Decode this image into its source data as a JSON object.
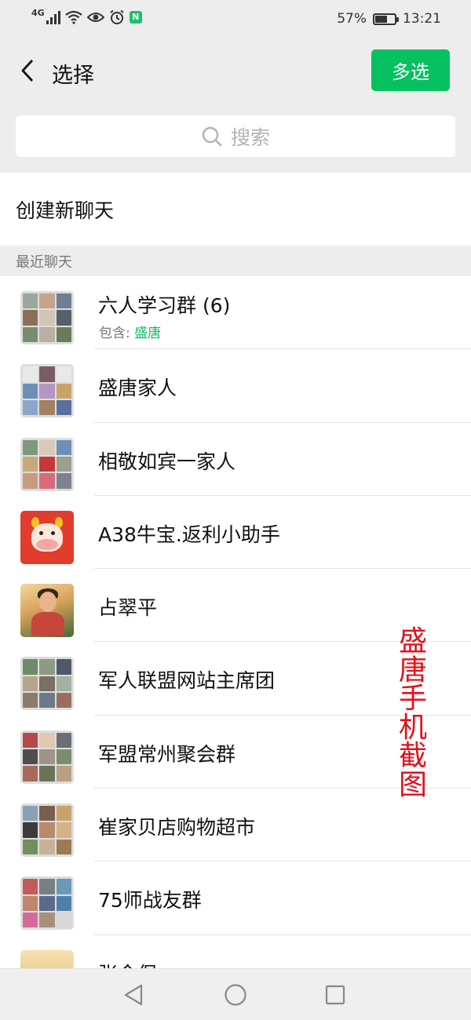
{
  "status_bar": {
    "network": "4G",
    "battery": "57%",
    "battery_level": 0.57,
    "time": "13:21",
    "icons": [
      "signal-icon",
      "wifi-icon",
      "eye-icon",
      "alarm-icon",
      "app-badge-icon"
    ]
  },
  "header": {
    "title": "选择",
    "multi_select_label": "多选"
  },
  "search": {
    "placeholder": "搜索"
  },
  "create_chat": "创建新聊天",
  "section_label": "最近聊天",
  "chats": [
    {
      "name": "六人学习群 (6)",
      "sub_prefix": "包含: ",
      "sub_highlight": "盛唐",
      "avatar": "group-grid"
    },
    {
      "name": "盛唐家人",
      "avatar": "group-grid"
    },
    {
      "name": "相敬如宾一家人",
      "avatar": "group-grid"
    },
    {
      "name": "A38牛宝.返利小助手",
      "avatar": "cow-cartoon"
    },
    {
      "name": "占翠平",
      "avatar": "photo-child"
    },
    {
      "name": "军人联盟网站主席团",
      "avatar": "group-grid"
    },
    {
      "name": "军盟常州聚会群",
      "avatar": "group-grid"
    },
    {
      "name": "崔家贝店购物超市",
      "avatar": "group-grid"
    },
    {
      "name": "75师战友群",
      "avatar": "group-grid"
    },
    {
      "name": "张金保",
      "avatar": "photo-sunset"
    }
  ],
  "watermark": [
    "盛",
    "唐",
    "手",
    "机",
    "截",
    "图"
  ],
  "colors": {
    "accent_green": "#07c160",
    "watermark_red": "#e4101b"
  },
  "nav_bar": [
    "back-nav-icon",
    "home-nav-icon",
    "recents-nav-icon"
  ]
}
